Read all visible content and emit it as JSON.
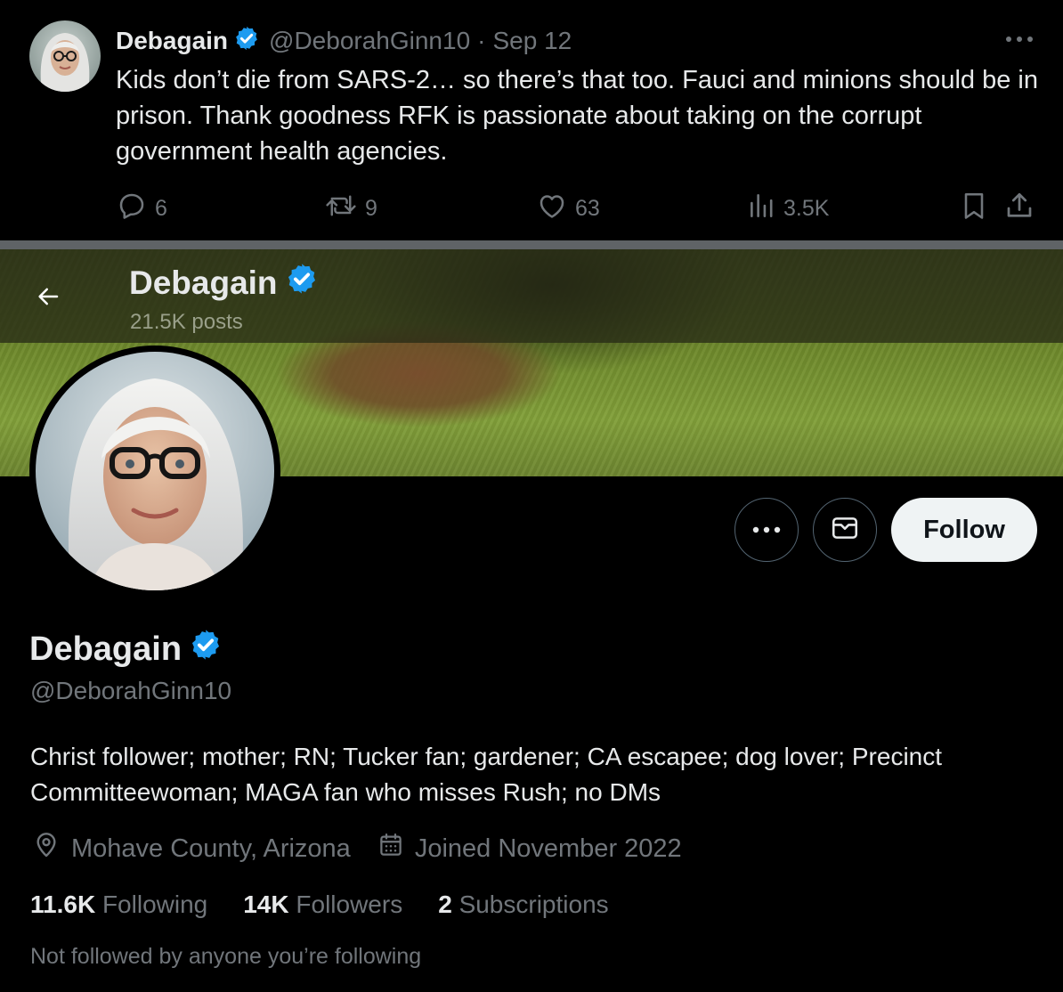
{
  "tweet": {
    "author_name": "Debagain",
    "handle": "@DeborahGinn10",
    "separator": "·",
    "date": "Sep 12",
    "text": "Kids don’t die from SARS-2… so there’s that too. Fauci and minions should be in prison. Thank goodness RFK is passionate about taking on the corrupt government health agencies.",
    "replies": "6",
    "reposts": "9",
    "likes": "63",
    "views": "3.5K"
  },
  "profile_header": {
    "name": "Debagain",
    "posts": "21.5K posts"
  },
  "profile": {
    "name": "Debagain",
    "handle": "@DeborahGinn10",
    "bio": "Christ follower; mother; RN; Tucker fan; gardener; CA escapee; dog lover; Precinct Committeewoman; MAGA fan who misses Rush; no DMs",
    "location": "Mohave County, Arizona",
    "joined": "Joined November 2022",
    "following_count": "11.6K",
    "following_label": "Following",
    "followers_count": "14K",
    "followers_label": "Followers",
    "subscriptions_count": "2",
    "subscriptions_label": "Subscriptions",
    "note": "Not followed by anyone you’re following",
    "follow_button": "Follow"
  },
  "icons": {
    "verified": "verified-badge-icon",
    "reply": "reply-icon",
    "repost": "repost-icon",
    "like": "heart-icon",
    "views": "views-icon",
    "bookmark": "bookmark-icon",
    "share": "share-icon",
    "back": "back-arrow-icon",
    "more": "more-icon",
    "message": "envelope-icon",
    "location": "location-pin-icon",
    "calendar": "calendar-icon"
  },
  "colors": {
    "background": "#000000",
    "text": "#e7e9ea",
    "muted": "#71767b",
    "verified": "#1d9bf0",
    "follow_button_bg": "#eff3f4",
    "divider": "#5f6366"
  }
}
